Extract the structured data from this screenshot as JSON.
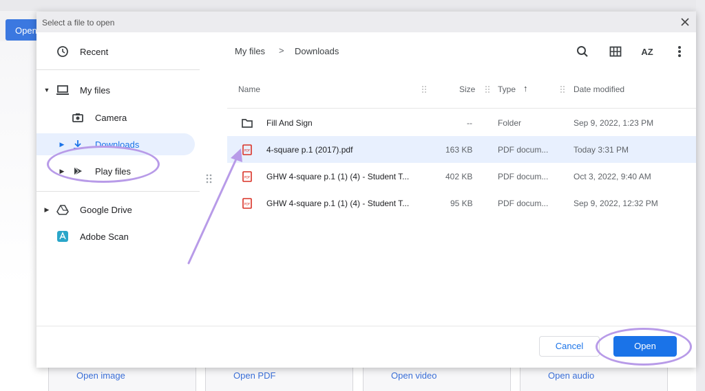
{
  "background": {
    "open_button": "Open",
    "links": [
      "Open image",
      "Open PDF",
      "Open video",
      "Open audio"
    ]
  },
  "dialog": {
    "title": "Select a file to open",
    "sidebar": {
      "recent": "Recent",
      "my_files": "My files",
      "camera": "Camera",
      "downloads": "Downloads",
      "play_files": "Play files",
      "google_drive": "Google Drive",
      "adobe_scan": "Adobe Scan"
    },
    "breadcrumb": [
      "My files",
      "Downloads"
    ],
    "breadcrumb_separator": ">",
    "toolbar_icons": [
      "search-icon",
      "grid-view-icon",
      "sort-az-icon",
      "more-vert-icon"
    ],
    "sort_label": "AZ",
    "columns": {
      "name": "Name",
      "size": "Size",
      "type": "Type",
      "date": "Date modified",
      "sort_arrow": "↑"
    },
    "files": [
      {
        "name": "Fill And Sign",
        "size": "--",
        "type": "Folder",
        "date": "Sep 9, 2022, 1:23 PM",
        "icon": "folder-icon",
        "selected": false
      },
      {
        "name": "4-square p.1 (2017).pdf",
        "size": "163 KB",
        "type": "PDF docum...",
        "date": "Today 3:31 PM",
        "icon": "pdf-icon",
        "selected": true
      },
      {
        "name": "GHW 4-square p.1 (1) (4) - Student T...",
        "size": "402 KB",
        "type": "PDF docum...",
        "date": "Oct 3, 2022, 9:40 AM",
        "icon": "pdf-icon",
        "selected": false
      },
      {
        "name": "GHW 4-square p.1 (1) (4) - Student T...",
        "size": "95 KB",
        "type": "PDF docum...",
        "date": "Sep 9, 2022, 12:32 PM",
        "icon": "pdf-icon",
        "selected": false
      }
    ],
    "cancel": "Cancel",
    "open": "Open"
  },
  "colors": {
    "accent": "#1a73e8",
    "selection": "#e8f0fe",
    "annotation": "#b89be8",
    "pdf_red": "#d93025"
  }
}
